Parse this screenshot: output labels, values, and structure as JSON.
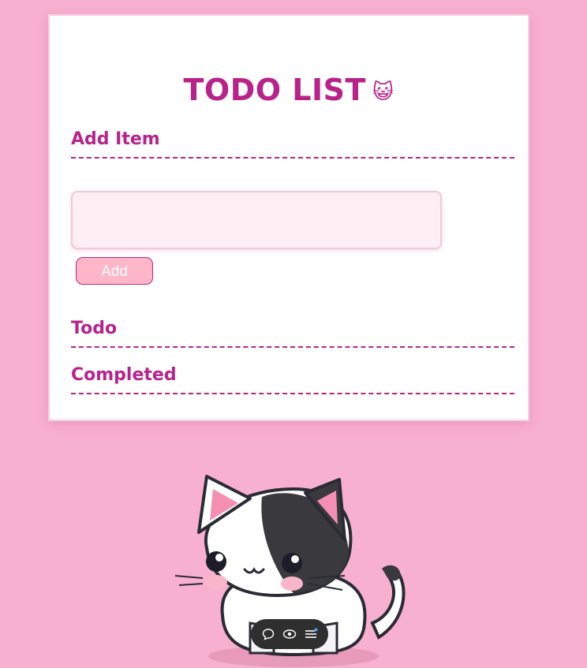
{
  "app": {
    "title": "TODO LIST",
    "title_emoji": "😺"
  },
  "sections": {
    "add_item": "Add Item",
    "todo": "Todo",
    "completed": "Completed"
  },
  "input": {
    "value": "",
    "placeholder": ""
  },
  "buttons": {
    "add_label": "Add"
  },
  "toolbar": {
    "icons": [
      "chat-icon",
      "eye-icon",
      "menu-icon"
    ]
  },
  "colors": {
    "accent": "#b8238a",
    "background": "#f8b0d0",
    "button": "#ffb6c9",
    "input_bg": "#fdeff4"
  }
}
